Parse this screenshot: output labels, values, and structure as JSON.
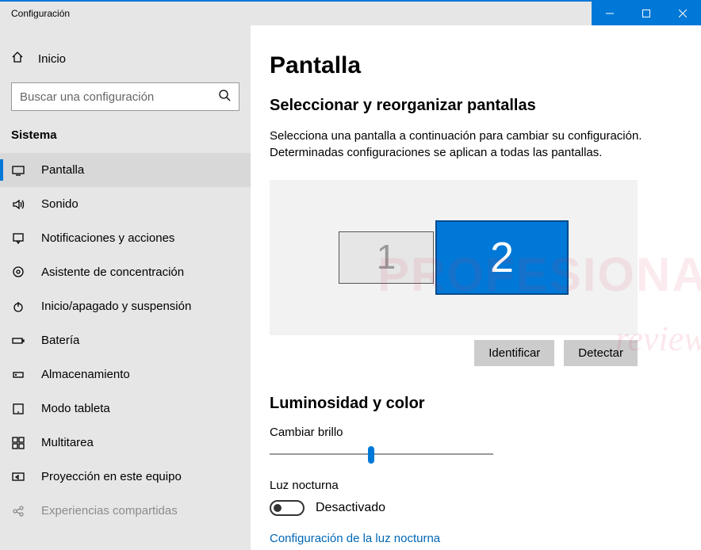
{
  "window": {
    "title": "Configuración"
  },
  "sidebar": {
    "home": "Inicio",
    "search_placeholder": "Buscar una configuración",
    "section": "Sistema",
    "items": [
      {
        "label": "Pantalla",
        "icon": "display-icon",
        "active": true
      },
      {
        "label": "Sonido",
        "icon": "sound-icon"
      },
      {
        "label": "Notificaciones y acciones",
        "icon": "notifications-icon"
      },
      {
        "label": "Asistente de concentración",
        "icon": "focus-assist-icon"
      },
      {
        "label": "Inicio/apagado y suspensión",
        "icon": "power-icon"
      },
      {
        "label": "Batería",
        "icon": "battery-icon"
      },
      {
        "label": "Almacenamiento",
        "icon": "storage-icon"
      },
      {
        "label": "Modo tableta",
        "icon": "tablet-icon"
      },
      {
        "label": "Multitarea",
        "icon": "multitask-icon"
      },
      {
        "label": "Proyección en este equipo",
        "icon": "project-icon"
      },
      {
        "label": "Experiencias compartidas",
        "icon": "shared-icon"
      }
    ]
  },
  "main": {
    "title": "Pantalla",
    "arrange_heading": "Seleccionar y reorganizar pantallas",
    "arrange_desc": "Selecciona una pantalla a continuación para cambiar su configuración. Determinadas configuraciones se aplican a todas las pantallas.",
    "monitors": {
      "m1": "1",
      "m2": "2",
      "selected": 2
    },
    "identify": "Identificar",
    "detect": "Detectar",
    "brightness_heading": "Luminosidad y color",
    "brightness_label": "Cambiar brillo",
    "brightness_value": 44,
    "night_light_label": "Luz nocturna",
    "night_light_state": "Desactivado",
    "night_light_settings": "Configuración de la luz nocturna"
  },
  "watermark": {
    "line1": "PROFESIONAL",
    "line2": "review"
  }
}
